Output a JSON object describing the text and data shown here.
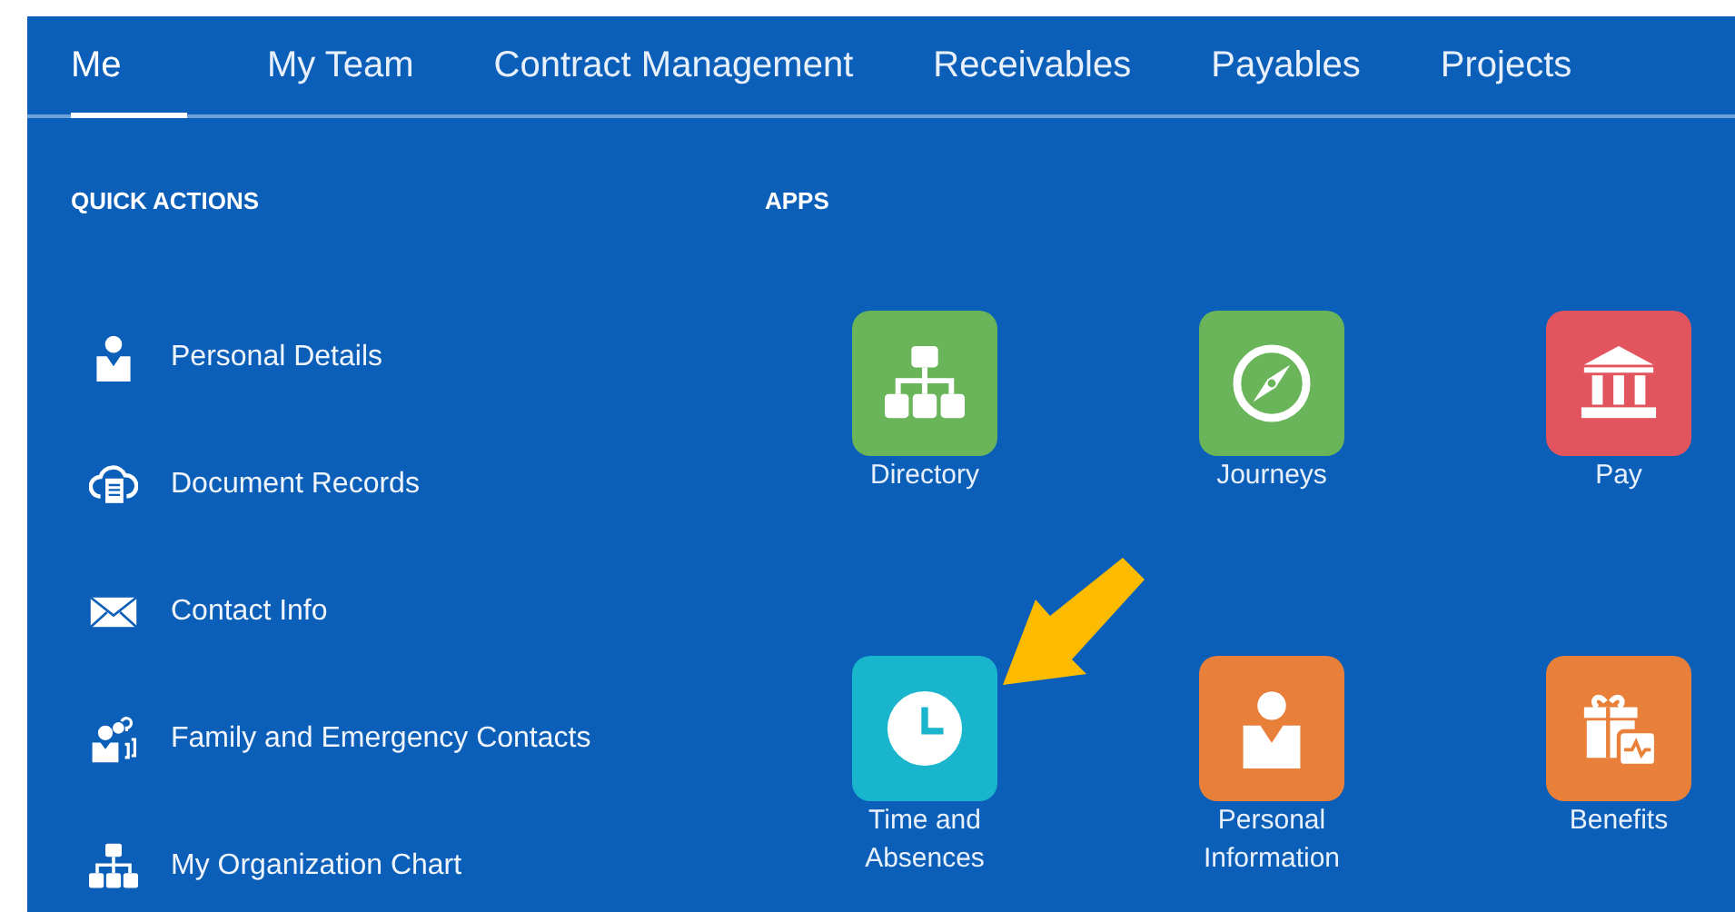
{
  "tabs": [
    {
      "label": "Me",
      "selected": true
    },
    {
      "label": "My Team",
      "selected": false
    },
    {
      "label": "Contract Management",
      "selected": false
    },
    {
      "label": "Receivables",
      "selected": false
    },
    {
      "label": "Payables",
      "selected": false
    },
    {
      "label": "Projects",
      "selected": false
    }
  ],
  "quick_actions": {
    "heading": "QUICK ACTIONS",
    "items": [
      {
        "kind": "person",
        "label": "Personal Details"
      },
      {
        "kind": "cloud",
        "label": "Document Records"
      },
      {
        "kind": "mail",
        "label": "Contact Info"
      },
      {
        "kind": "family",
        "label": "Family and Emergency Contacts"
      },
      {
        "kind": "org",
        "label": "My Organization Chart"
      }
    ]
  },
  "apps": {
    "heading": "APPS",
    "items": [
      {
        "kind": "org",
        "label": "Directory",
        "color": "#6ab55a"
      },
      {
        "kind": "compass",
        "label": "Journeys",
        "color": "#6ab55a"
      },
      {
        "kind": "bank",
        "label": "Pay",
        "color": "#e2555f"
      },
      {
        "kind": "clock",
        "label": "Time and Absences",
        "color": "#19b5cc"
      },
      {
        "kind": "person",
        "label": "Personal Information",
        "color": "#e8803a"
      },
      {
        "kind": "gift",
        "label": "Benefits",
        "color": "#e8803a"
      }
    ]
  }
}
